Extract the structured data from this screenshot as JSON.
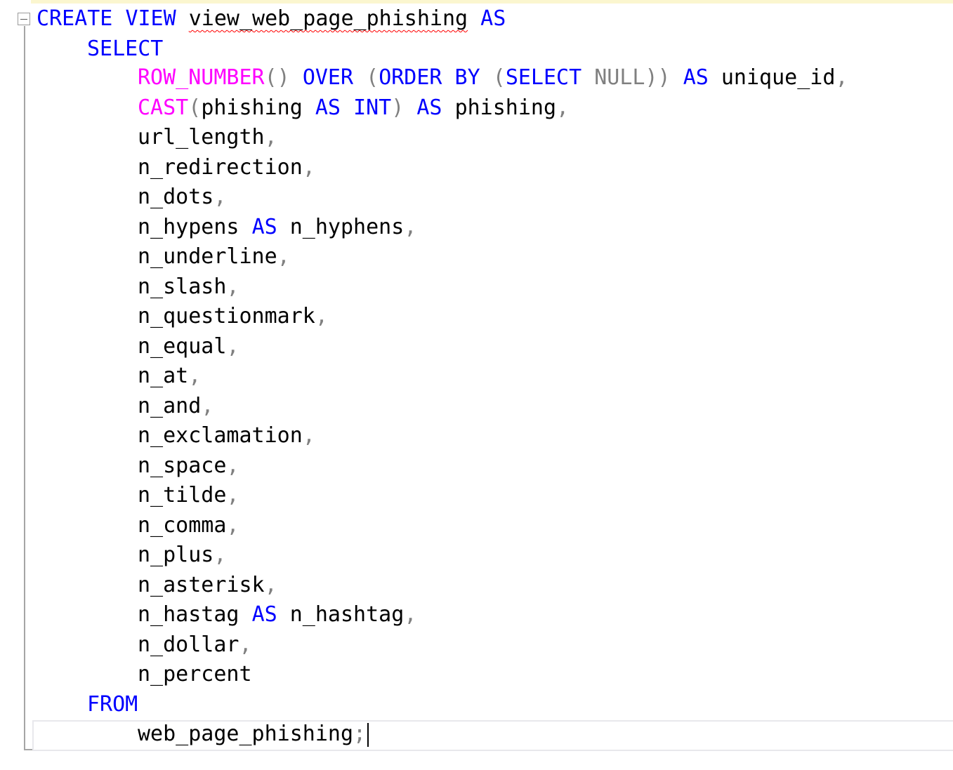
{
  "editor": {
    "colors": {
      "keyword": "#0000ff",
      "function": "#ff00ff",
      "operator": "#808080",
      "identifier": "#000000",
      "error_squiggle": "#ff0000"
    },
    "lines": [
      {
        "kw1": "CREATE",
        "kw2": "VIEW",
        "name": "view_web_page_phishing",
        "kw3": "AS"
      },
      {
        "kw": "SELECT"
      },
      {
        "fn": "ROW_NUMBER",
        "p1": "()",
        "kw1": "OVER",
        "p2": "(",
        "kw2": "ORDER BY",
        "p3": "(",
        "kw3": "SELECT",
        "null": "NULL",
        "p4": "))",
        "kw4": "AS",
        "alias": "unique_id",
        "comma": ","
      },
      {
        "fn": "CAST",
        "p1": "(",
        "col": "phishing",
        "kw1": "AS",
        "kw2": "INT",
        "p2": ")",
        "kw3": "AS",
        "alias": "phishing",
        "comma": ","
      },
      {
        "col": "url_length",
        "comma": ","
      },
      {
        "col": "n_redirection",
        "comma": ","
      },
      {
        "col": "n_dots",
        "comma": ","
      },
      {
        "col": "n_hypens",
        "kw": "AS",
        "alias": "n_hyphens",
        "comma": ","
      },
      {
        "col": "n_underline",
        "comma": ","
      },
      {
        "col": "n_slash",
        "comma": ","
      },
      {
        "col": "n_questionmark",
        "comma": ","
      },
      {
        "col": "n_equal",
        "comma": ","
      },
      {
        "col": "n_at",
        "comma": ","
      },
      {
        "col": "n_and",
        "comma": ","
      },
      {
        "col": "n_exclamation",
        "comma": ","
      },
      {
        "col": "n_space",
        "comma": ","
      },
      {
        "col": "n_tilde",
        "comma": ","
      },
      {
        "col": "n_comma",
        "comma": ","
      },
      {
        "col": "n_plus",
        "comma": ","
      },
      {
        "col": "n_asterisk",
        "comma": ","
      },
      {
        "col": "n_hastag",
        "kw": "AS",
        "alias": "n_hashtag",
        "comma": ","
      },
      {
        "col": "n_dollar",
        "comma": ","
      },
      {
        "col": "n_percent"
      },
      {
        "kw": "FROM"
      },
      {
        "table": "web_page_phishing",
        "semi": ";"
      }
    ]
  }
}
